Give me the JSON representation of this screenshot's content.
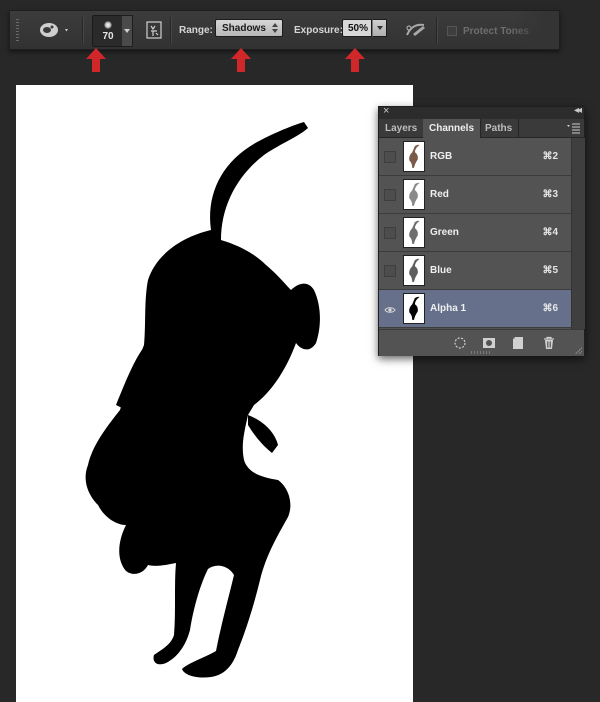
{
  "options_bar": {
    "tool_icon": "dodge-burn-sponge-tool-icon",
    "brush_size": "70",
    "range_label": "Range:",
    "range_value": "Shadows",
    "exposure_label": "Exposure:",
    "exposure_value": "50%",
    "airbrush_icon": "airbrush-icon",
    "protect_tones_label": "Protect Tones"
  },
  "annotations": {
    "arrow_color": "#d0282a",
    "arrows": [
      "brush-size-arrow",
      "range-arrow",
      "exposure-arrow"
    ]
  },
  "channels_panel": {
    "tabs": [
      {
        "label": "Layers",
        "active": false
      },
      {
        "label": "Channels",
        "active": true
      },
      {
        "label": "Paths",
        "active": false
      }
    ],
    "channels": [
      {
        "name": "RGB",
        "shortcut": "⌘2",
        "visible": false,
        "selected": false
      },
      {
        "name": "Red",
        "shortcut": "⌘3",
        "visible": false,
        "selected": false
      },
      {
        "name": "Green",
        "shortcut": "⌘4",
        "visible": false,
        "selected": false
      },
      {
        "name": "Blue",
        "shortcut": "⌘5",
        "visible": false,
        "selected": false
      },
      {
        "name": "Alpha 1",
        "shortcut": "⌘6",
        "visible": true,
        "selected": true
      }
    ],
    "footer_icons": [
      "load-selection-icon",
      "save-selection-icon",
      "new-channel-icon",
      "delete-channel-icon"
    ],
    "selection_color": "#66708a"
  }
}
